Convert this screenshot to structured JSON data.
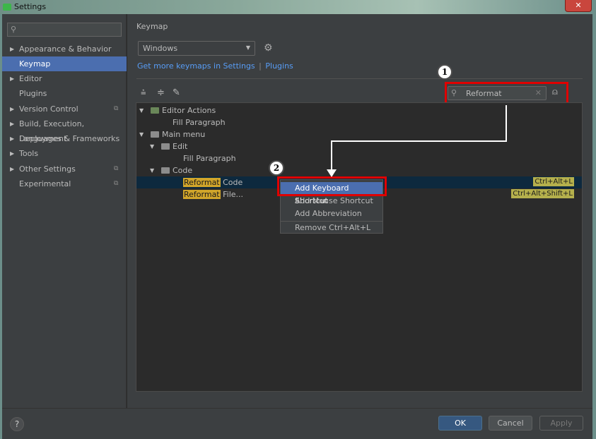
{
  "window": {
    "title": "Settings",
    "close_glyph": "✕"
  },
  "sidebar": {
    "search_placeholder": "",
    "items": [
      {
        "label": "Appearance & Behavior",
        "arrow": "▶",
        "project": ""
      },
      {
        "label": "Keymap",
        "arrow": "",
        "project": ""
      },
      {
        "label": "Editor",
        "arrow": "▶",
        "project": ""
      },
      {
        "label": "Plugins",
        "arrow": "",
        "project": ""
      },
      {
        "label": "Version Control",
        "arrow": "▶",
        "project": "⧉"
      },
      {
        "label": "Build, Execution, Deployment",
        "arrow": "▶",
        "project": ""
      },
      {
        "label": "Languages & Frameworks",
        "arrow": "▶",
        "project": ""
      },
      {
        "label": "Tools",
        "arrow": "▶",
        "project": ""
      },
      {
        "label": "Other Settings",
        "arrow": "▶",
        "project": "⧉"
      },
      {
        "label": "Experimental",
        "arrow": "",
        "project": "⧉"
      }
    ],
    "selected_index": 1
  },
  "main": {
    "heading": "Keymap",
    "keymap_select": "Windows",
    "link_get_more": "Get more keymaps in Settings",
    "link_sep": "|",
    "link_plugins": "Plugins",
    "filter_value": "Reformat"
  },
  "tree": {
    "rows": [
      {
        "arrow": "▼",
        "icon": "action",
        "text": "Editor Actions",
        "highlight": "",
        "shortcut": ""
      },
      {
        "arrow": "",
        "icon": "",
        "text": "Fill Paragraph",
        "highlight": "",
        "shortcut": ""
      },
      {
        "arrow": "▼",
        "icon": "folder",
        "text": "Main menu",
        "highlight": "",
        "shortcut": ""
      },
      {
        "arrow": "▼",
        "icon": "folder",
        "text": "Edit",
        "highlight": "",
        "shortcut": ""
      },
      {
        "arrow": "",
        "icon": "",
        "text": "Fill Paragraph",
        "highlight": "",
        "shortcut": ""
      },
      {
        "arrow": "▼",
        "icon": "folder",
        "text": "Code",
        "highlight": "",
        "shortcut": ""
      },
      {
        "arrow": "",
        "icon": "",
        "text": " Code",
        "highlight": "Reformat",
        "shortcut": "Ctrl+Alt+L"
      },
      {
        "arrow": "",
        "icon": "",
        "text": " File...",
        "highlight": "Reformat",
        "shortcut": "Ctrl+Alt+Shift+L"
      }
    ]
  },
  "context_menu": {
    "items": [
      "Add Keyboard Shortcut",
      "Add Mouse Shortcut",
      "Add Abbreviation",
      "Remove Ctrl+Alt+L"
    ]
  },
  "annotations": {
    "badge1": "1",
    "badge2": "2",
    "highlight_color": "#e00000"
  },
  "footer": {
    "help": "?",
    "ok": "OK",
    "cancel": "Cancel",
    "apply": "Apply"
  },
  "colors": {
    "selection": "#4b6eaf",
    "link": "#589df6",
    "match": "#d1a52a"
  }
}
